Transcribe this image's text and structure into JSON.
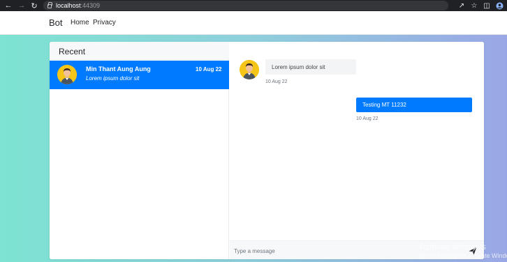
{
  "browser": {
    "url_host": "localhost",
    "url_port": ":44309",
    "icons": [
      "back-icon",
      "forward-icon",
      "reload-icon",
      "lock-icon",
      "share-icon",
      "star-icon",
      "sidepanel-icon",
      "profile-icon"
    ]
  },
  "navbar": {
    "brand": "Bot",
    "links": [
      "Home",
      "Privacy"
    ]
  },
  "sidebar": {
    "title": "Recent",
    "conversations": [
      {
        "name": "Min Thant Aung Aung",
        "date": "10 Aug 22",
        "preview": "Lorem ipsum dolor sit",
        "active": true
      }
    ]
  },
  "chat": {
    "messages": [
      {
        "direction": "incoming",
        "text": "Lorem ipsum dolor sit",
        "time": "10 Aug 22"
      },
      {
        "direction": "outgoing",
        "text": "Testing MT 11232",
        "time": "10 Aug 22"
      }
    ],
    "input_placeholder": "Type a message",
    "send_icon": "paper-plane-icon"
  },
  "watermark": {
    "title": "Activate Windows",
    "subtitle": "Go to Settings to activate Windows."
  },
  "colors": {
    "accent": "#007bff",
    "gradient_start": "#7de3d2",
    "gradient_end": "#9aa7e6",
    "avatar_bg": "#f5c518"
  }
}
